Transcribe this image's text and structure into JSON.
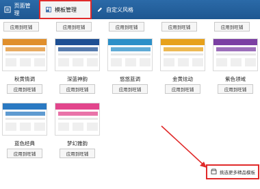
{
  "tabs": [
    {
      "label": "页面管理",
      "icon": "page-icon"
    },
    {
      "label": "模板管理",
      "icon": "template-icon"
    },
    {
      "label": "自定义风格",
      "icon": "edit-icon"
    }
  ],
  "apply_label": "应用到旺铺",
  "top_row_buttons": [
    "应用到旺铺",
    "应用到旺铺",
    "应用到旺铺",
    "应用到旺铺",
    "应用到旺铺"
  ],
  "templates": [
    {
      "name": "秋黄情调",
      "color": "#e08f2c"
    },
    {
      "name": "深蓝神韵",
      "color": "#1e4f93"
    },
    {
      "name": "悠悠蓝调",
      "color": "#2b8fc8"
    },
    {
      "name": "金黄炫动",
      "color": "#e7a11b"
    },
    {
      "name": "紫色领域",
      "color": "#7b3fa3"
    },
    {
      "name": "蓝色经典",
      "color": "#2a79c2"
    },
    {
      "name": "梦幻雅韵",
      "color": "#e2458c"
    }
  ],
  "more_templates": {
    "label": "挑选更多精品模板",
    "icon": "store-icon"
  },
  "colors": {
    "tabbar": "#1e5791",
    "highlight": "#e02a2a"
  }
}
